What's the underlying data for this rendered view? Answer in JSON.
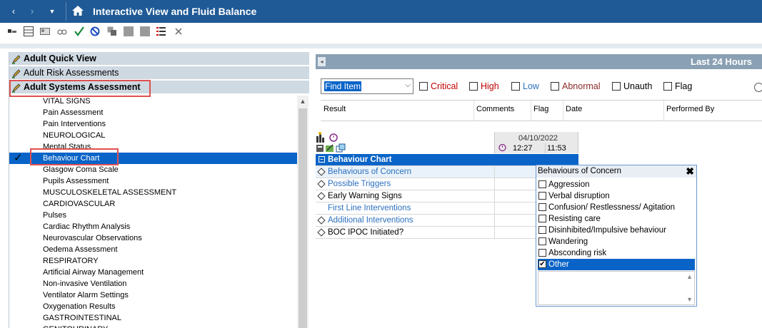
{
  "titlebar": {
    "title": "Interactive View and Fluid Balance",
    "nav_back": "‹",
    "nav_forward": "›",
    "nav_dropdown": "▼"
  },
  "toolbar": {
    "icons": [
      "tag-icon",
      "grid-icon",
      "card-icon",
      "glasses-icon",
      "check-icon",
      "cancel-icon",
      "copy-icon",
      "gray-square-icon",
      "gray-square-icon",
      "list-icon",
      "close-icon"
    ]
  },
  "left_panel": {
    "sections": [
      {
        "label": "Adult Quick View",
        "bold": true
      },
      {
        "label": "Adult Risk Assessments",
        "bold": false
      },
      {
        "label": "Adult Systems Assessment",
        "bold": true
      }
    ],
    "items": [
      "VITAL SIGNS",
      "Pain Assessment",
      "Pain Interventions",
      "NEUROLOGICAL",
      "Mental Status",
      "Behaviour Chart",
      "Glasgow Coma Scale",
      "Pupils Assessment",
      "MUSCULOSKELETAL ASSESSMENT",
      "CARDIOVASCULAR",
      "Pulses",
      "Cardiac Rhythm Analysis",
      "Neurovascular Observations",
      "Oedema Assessment",
      "RESPIRATORY",
      "Artificial Airway Management",
      "Non-invasive Ventilation",
      "Ventilator Alarm Settings",
      "Oxygenation Results",
      "GASTROINTESTINAL",
      "GENITOURINARY"
    ],
    "selected_item": "Behaviour Chart",
    "check_mark": "✓"
  },
  "time_range": "Last 24 Hours",
  "filters": {
    "find_item": "Find Item",
    "options": [
      "Critical",
      "High",
      "Low",
      "Abnormal",
      "Unauth",
      "Flag"
    ],
    "colors": {
      "Critical": "#c00000",
      "High": "#c00000",
      "Low": "#2b6fbf",
      "Abnormal": "#8b2a2a",
      "Unauth": "#000000",
      "Flag": "#000000"
    }
  },
  "result_columns": [
    "Result",
    "Comments",
    "Flag",
    "Date",
    "Performed By"
  ],
  "flowsheet": {
    "date": "04/10/2022",
    "times": [
      "12:27",
      "11:53"
    ],
    "section": "Behaviour Chart",
    "rows": [
      {
        "label": "Behaviours of Concern",
        "link": true,
        "icon": "diamond-down"
      },
      {
        "label": "Possible Triggers",
        "link": true,
        "icon": "diamond"
      },
      {
        "label": "Early Warning Signs",
        "link": false,
        "icon": "diamond"
      },
      {
        "label": "First Line Interventions",
        "link": true,
        "icon": "none"
      },
      {
        "label": "Additional Interventions",
        "link": true,
        "icon": "diamond"
      },
      {
        "label": "BOC IPOC Initiated?",
        "link": false,
        "icon": "diamond-down"
      }
    ]
  },
  "popup": {
    "title": "Behaviours of Concern",
    "close": "✖",
    "options": [
      {
        "label": "Aggression",
        "checked": false
      },
      {
        "label": "Verbal disruption",
        "checked": false
      },
      {
        "label": "Confusion/ Restlessness/ Agitation",
        "checked": false
      },
      {
        "label": "Resisting care",
        "checked": false
      },
      {
        "label": "Disinhibited/Impulsive behaviour",
        "checked": false
      },
      {
        "label": "Wandering",
        "checked": false
      },
      {
        "label": "Absconding risk",
        "checked": false
      },
      {
        "label": "Other",
        "checked": true
      }
    ],
    "check_glyph": "✔"
  }
}
